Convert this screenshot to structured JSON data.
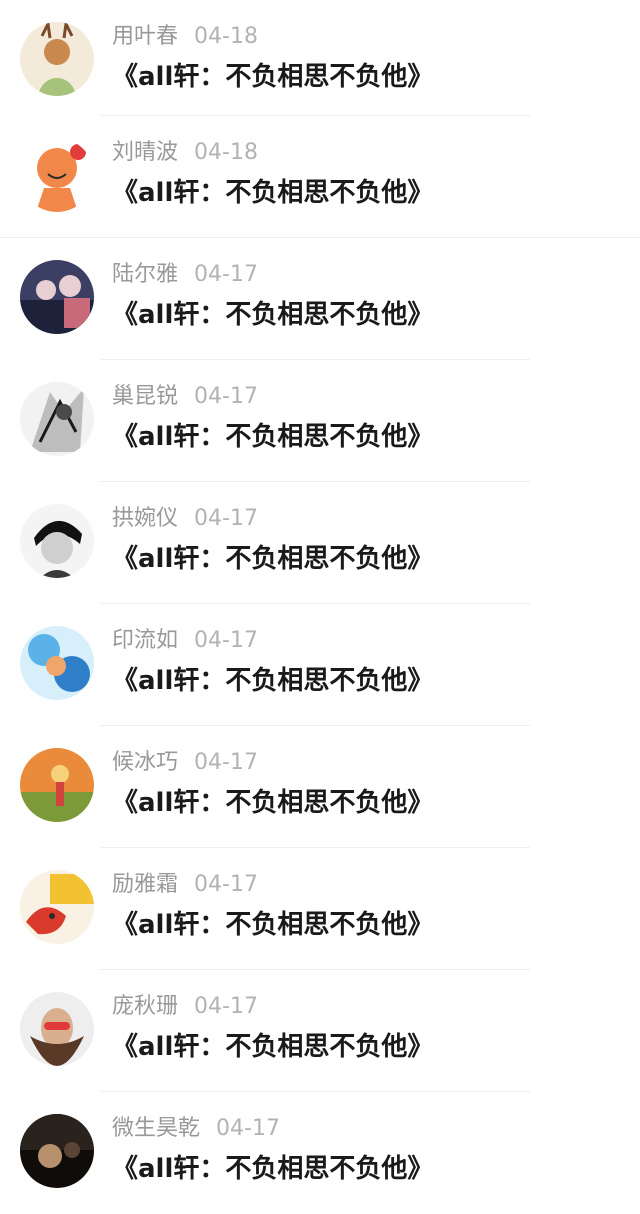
{
  "comments": [
    {
      "name": "用叶春",
      "date": "04-18",
      "title": "《all轩：不负相思不负他》",
      "avatar": "deer-girl-avatar",
      "colors": [
        "#f3ead9",
        "#a6c27b",
        "#c9884d",
        "#7a4a2b"
      ]
    },
    {
      "name": "刘晴波",
      "date": "04-18",
      "title": "《all轩：不负相思不负他》",
      "avatar": "cartoon-boy-avatar",
      "colors": [
        "#ffffff",
        "#f2874a",
        "#e23b3b",
        "#2b2b2b"
      ]
    },
    {
      "name": "陆尔雅",
      "date": "04-17",
      "title": "《all轩：不负相思不负他》",
      "avatar": "group-photo-avatar",
      "colors": [
        "#3b3f63",
        "#c96a7a",
        "#1d223a",
        "#e8cfd3"
      ]
    },
    {
      "name": "巢昆锐",
      "date": "04-17",
      "title": "《all轩：不负相思不负他》",
      "avatar": "sketch-avatar",
      "colors": [
        "#f2f2f2",
        "#bdbdbd",
        "#4a4a4a",
        "#1a1a1a"
      ]
    },
    {
      "name": "拱婉仪",
      "date": "04-17",
      "title": "《all轩：不负相思不负他》",
      "avatar": "manga-boy-avatar",
      "colors": [
        "#f4f4f4",
        "#cfcfcf",
        "#3a3a3a",
        "#111111"
      ]
    },
    {
      "name": "印流如",
      "date": "04-17",
      "title": "《all轩：不负相思不负他》",
      "avatar": "watercolor-avatar",
      "colors": [
        "#d7eefb",
        "#5bb2e8",
        "#2f7fc8",
        "#f0a66a"
      ]
    },
    {
      "name": "候冰巧",
      "date": "04-17",
      "title": "《all轩：不负相思不负他》",
      "avatar": "sunset-girl-avatar",
      "colors": [
        "#f6d27a",
        "#e98b3a",
        "#7d9a3a",
        "#d2443b"
      ]
    },
    {
      "name": "励雅霜",
      "date": "04-17",
      "title": "《all轩：不负相思不负他》",
      "avatar": "red-bird-avatar",
      "colors": [
        "#f8f1e4",
        "#f2c232",
        "#d93a2b",
        "#2a2a2a"
      ]
    },
    {
      "name": "庞秋珊",
      "date": "04-17",
      "title": "《all轩：不负相思不负他》",
      "avatar": "mustache-man-avatar",
      "colors": [
        "#eeeeee",
        "#d9b08f",
        "#e23a3a",
        "#5a3a26"
      ]
    },
    {
      "name": "微生昊乾",
      "date": "04-17",
      "title": "《all轩：不负相思不负他》",
      "avatar": "dark-photo-avatar",
      "colors": [
        "#2a221c",
        "#5a4436",
        "#b7906e",
        "#0f0c0a"
      ]
    }
  ]
}
